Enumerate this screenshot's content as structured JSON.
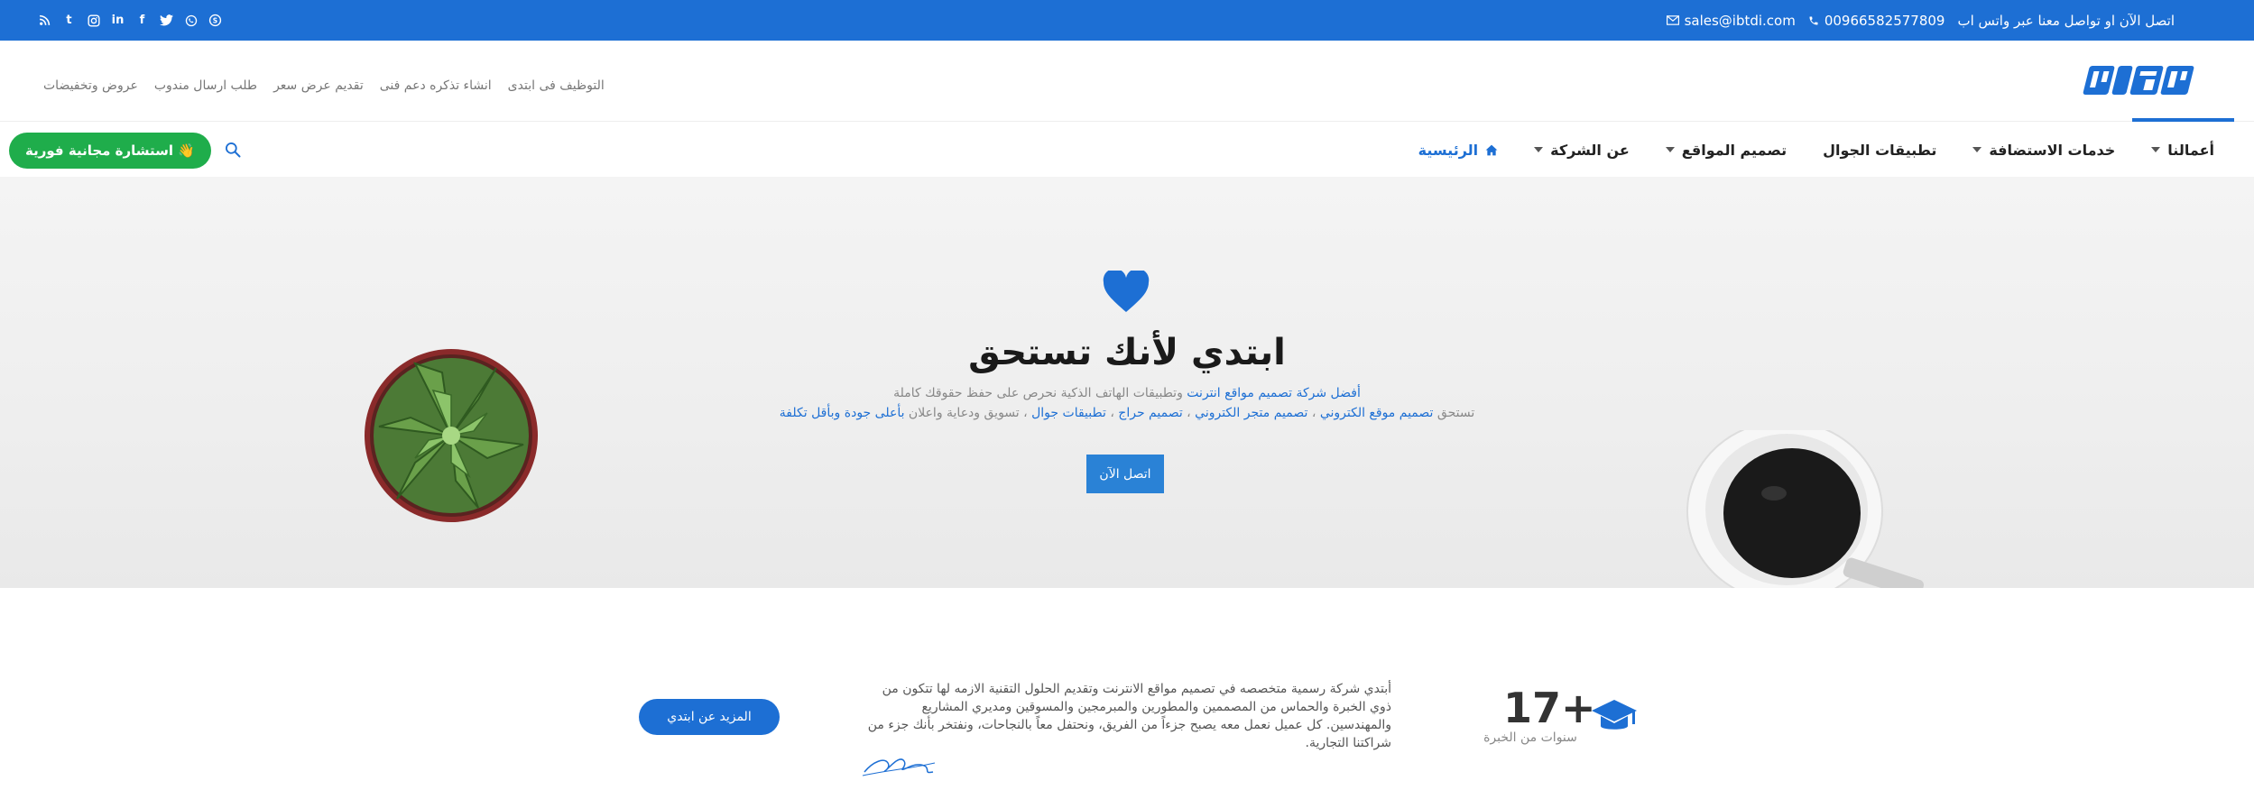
{
  "topbar": {
    "whatsapp_text": "اتصل الآن او تواصل معنا عبر واتس اب",
    "phone": "00966582577809",
    "email": "sales@ibtdi.com",
    "social_icons": [
      "skype-icon",
      "whatsapp-icon",
      "twitter-icon",
      "facebook-icon",
      "linkedin-icon",
      "instagram-icon",
      "tumblr-icon",
      "rss-icon"
    ]
  },
  "header": {
    "toplinks": [
      "عروض وتخفيضات",
      "طلب ارسال مندوب",
      "تقديم عرض سعر",
      "انشاء تذكره دعم فنى",
      "التوظيف فى ابتدى"
    ]
  },
  "nav": {
    "items": [
      {
        "label": "الرئيسية",
        "active": true,
        "caret": false,
        "icon": "home-icon"
      },
      {
        "label": "عن الشركة",
        "caret": true
      },
      {
        "label": "تصميم المواقع",
        "caret": true
      },
      {
        "label": "تطبيقات الجوال",
        "caret": false
      },
      {
        "label": "خدمات الاستضافة",
        "caret": true
      },
      {
        "label": "أعمالنا",
        "caret": true
      }
    ],
    "cta": "استشارة مجانية فورية 👋"
  },
  "hero": {
    "title": "ابتدي لأنك تستحق",
    "sub1_hl": "أفضل شركة تصميم مواقع انترنت",
    "sub1_rest": " وتطبيقات الهاتف الذكية نحرص على حفظ حقوقك كاملة",
    "sub2_a": "تستحق ",
    "sub2_b": "تصميم موقع الكتروني",
    "sub2_c": " ، ",
    "sub2_d": "تصميم متجر الكتروني",
    "sub2_e": " ، ",
    "sub2_f": "تصميم حراج",
    "sub2_g": " ، ",
    "sub2_h": "تطبيقات جوال",
    "sub2_i": " ، تسويق ودعاية واعلان ",
    "sub2_j": "بأعلى جودة وبأقل تكلفة",
    "button": "اتصل الآن"
  },
  "about": {
    "years": "17+",
    "years_label": "سنوات من الخبرة",
    "text": "أبتدي شركة رسمية متخصصه في تصميم مواقع الانترنت وتقديم الحلول التقنية الازمه لها تتكون من ذوي الخبرة والحماس من المصممين والمطورين والمبرمجين والمسوقين ومديري المشاريع والمهندسين. كل عميل نعمل معه يصبح جزءاً من الفريق، ونحتفل معاً بالنجاحات، ونفتخر بأنك جزء من شراكتنا التجارية.",
    "button": "المزيد عن ابتدي"
  },
  "colors": {
    "brand": "#1d6fd4",
    "cta": "#1fad4b"
  }
}
